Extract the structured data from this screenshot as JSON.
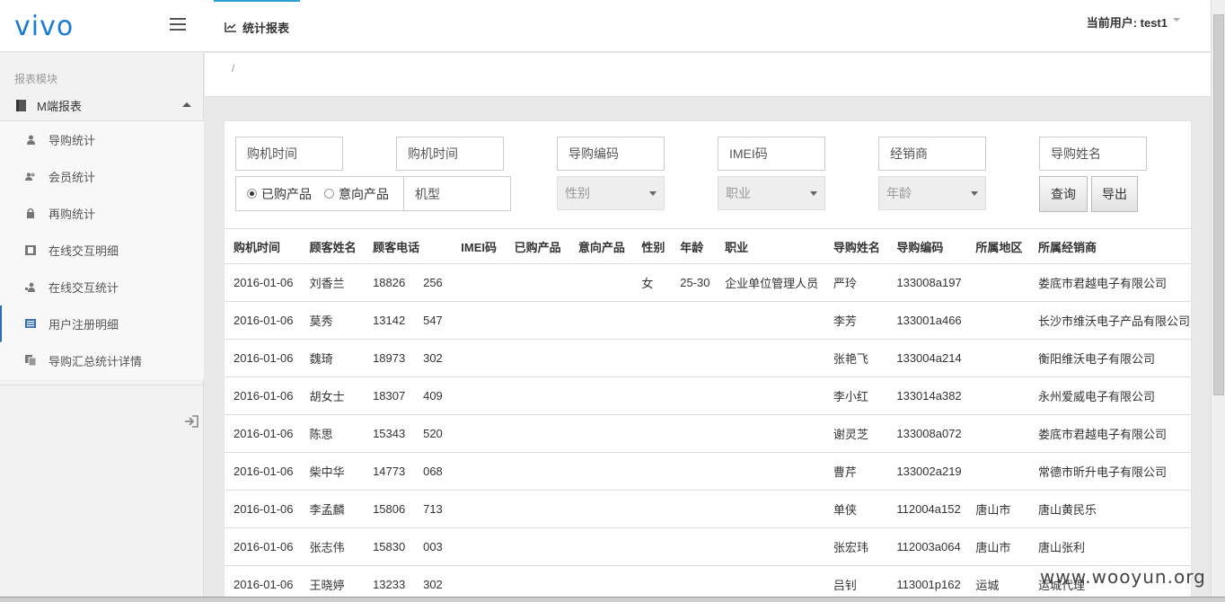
{
  "header": {
    "logo_text": "vivo",
    "tab_label": "统计报表",
    "user_label": "当前用户: test1"
  },
  "breadcrumb": "/",
  "sidebar": {
    "section_title": "报表模块",
    "group_label": "M端报表",
    "items": [
      {
        "label": "导购统计",
        "icon": "user-icon"
      },
      {
        "label": "会员统计",
        "icon": "users-icon"
      },
      {
        "label": "再购统计",
        "icon": "lock-icon"
      },
      {
        "label": "在线交互明细",
        "icon": "film-icon"
      },
      {
        "label": "在线交互统计",
        "icon": "user-edit-icon"
      },
      {
        "label": "用户注册明细",
        "icon": "list-icon"
      },
      {
        "label": "导购汇总统计详情",
        "icon": "copy-icon"
      }
    ]
  },
  "filters": {
    "buy_time_start": "购机时间",
    "buy_time_end": "购机时间",
    "guide_code": "导购编码",
    "imei": "IMEI码",
    "dealer": "经销商",
    "guide_name": "导购姓名",
    "radio_bought": "已购产品",
    "radio_intent": "意向产品",
    "model": "机型",
    "gender": "性别",
    "occupation": "职业",
    "age": "年龄",
    "query_button": "查询",
    "export_button": "导出"
  },
  "table": {
    "columns": [
      "购机时间",
      "顾客姓名",
      "顾客电话",
      "",
      "IMEI码",
      "已购产品",
      "意向产品",
      "性别",
      "年龄",
      "职业",
      "导购姓名",
      "导购编码",
      "所属地区",
      "所属经销商"
    ],
    "rows": [
      [
        "2016-01-06",
        "刘香兰",
        "18826",
        "256",
        "",
        "",
        "",
        "女",
        "25-30",
        "企业单位管理人员",
        "严玲",
        "133008a197",
        "",
        "娄底市君越电子有限公司"
      ],
      [
        "2016-01-06",
        "莫秀",
        "13142",
        "547",
        "",
        "",
        "",
        "",
        "",
        "",
        "李芳",
        "133001a466",
        "",
        "长沙市维沃电子产品有限公司"
      ],
      [
        "2016-01-06",
        "魏琦",
        "18973",
        "302",
        "",
        "",
        "",
        "",
        "",
        "",
        "张艳飞",
        "133004a214",
        "",
        "衡阳维沃电子有限公司"
      ],
      [
        "2016-01-06",
        "胡女士",
        "18307",
        "409",
        "",
        "",
        "",
        "",
        "",
        "",
        "李小红",
        "133014a382",
        "",
        "永州爱威电子有限公司"
      ],
      [
        "2016-01-06",
        "陈思",
        "15343",
        "520",
        "",
        "",
        "",
        "",
        "",
        "",
        "谢灵芝",
        "133008a072",
        "",
        "娄底市君越电子有限公司"
      ],
      [
        "2016-01-06",
        "柴中华",
        "14773",
        "068",
        "",
        "",
        "",
        "",
        "",
        "",
        "曹芹",
        "133002a219",
        "",
        "常德市昕升电子有限公司"
      ],
      [
        "2016-01-06",
        "李孟麟",
        "15806",
        "713",
        "",
        "",
        "",
        "",
        "",
        "",
        "单侠",
        "112004a152",
        "唐山市",
        "唐山黄民乐"
      ],
      [
        "2016-01-06",
        "张志伟",
        "15830",
        "003",
        "",
        "",
        "",
        "",
        "",
        "",
        "张宏玮",
        "112003a064",
        "唐山市",
        "唐山张利"
      ],
      [
        "2016-01-06",
        "王晓婷",
        "13233",
        "302",
        "",
        "",
        "",
        "",
        "",
        "",
        "吕钊",
        "113001p162",
        "运城",
        "运城代理"
      ]
    ]
  },
  "watermark": "www.wooyun.org"
}
